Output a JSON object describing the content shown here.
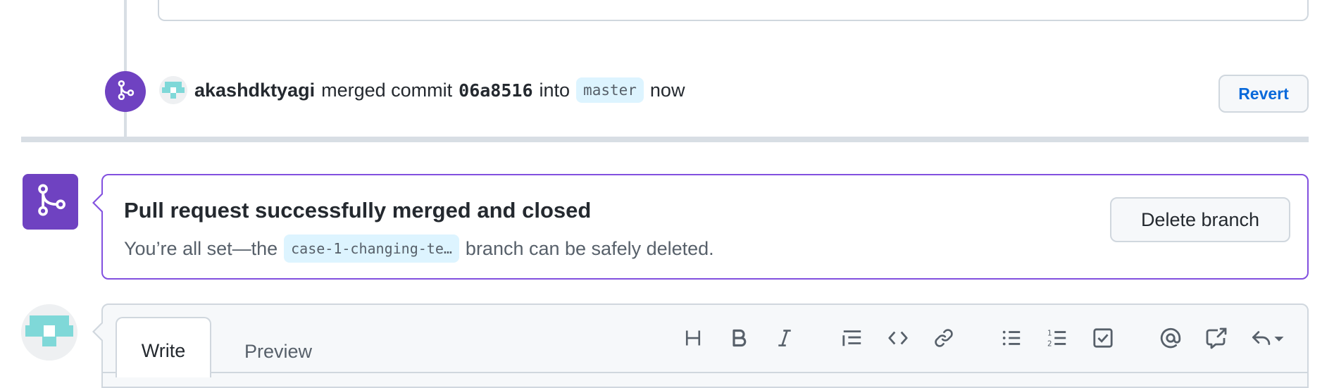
{
  "merge_event": {
    "username": "akashdktyagi",
    "action_text": "merged commit",
    "commit_sha": "06a8516",
    "into_text": "into",
    "target_branch": "master",
    "time": "now",
    "revert_label": "Revert"
  },
  "merged_box": {
    "title": "Pull request successfully merged and closed",
    "desc_before": "You’re all set—the",
    "branch_name": "case-1-changing-te…",
    "desc_after": "branch can be safely deleted.",
    "delete_button_label": "Delete branch"
  },
  "composer": {
    "tabs": [
      {
        "label": "Write",
        "active": true
      },
      {
        "label": "Preview",
        "active": false
      }
    ],
    "toolbar_icons": [
      "heading-icon",
      "bold-icon",
      "italic-icon",
      "quote-icon",
      "code-icon",
      "link-icon",
      "bulleted-list-icon",
      "numbered-list-icon",
      "task-list-icon",
      "mention-icon",
      "cross-reference-icon",
      "reply-icon"
    ]
  },
  "colors": {
    "merged_purple": "#6f42c1",
    "merged_border": "#8250df",
    "link_blue": "#0969da",
    "branch_pill_bg": "#ddf4ff",
    "border_gray": "#d0d7de"
  }
}
